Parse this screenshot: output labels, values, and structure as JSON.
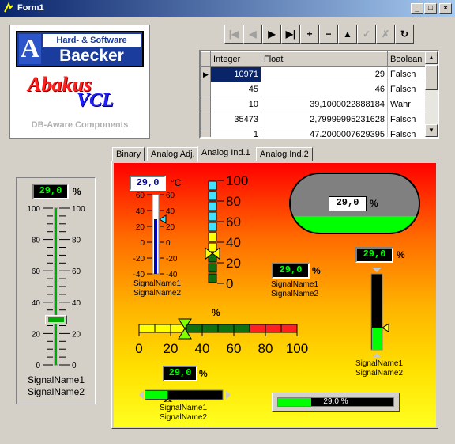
{
  "window": {
    "title": "Form1",
    "controls": {
      "minimize": "_",
      "maximize": "□",
      "close": "×"
    }
  },
  "logo": {
    "line1": "Hard- & Software",
    "line2": "Baecker",
    "brand1": "Abakus",
    "brand2": "VCL",
    "tagline": "DB-Aware Components"
  },
  "navigator": {
    "buttons": [
      {
        "name": "first",
        "glyph": "|◀",
        "enabled": false
      },
      {
        "name": "prior",
        "glyph": "◀",
        "enabled": false
      },
      {
        "name": "next",
        "glyph": "▶",
        "enabled": true
      },
      {
        "name": "last",
        "glyph": "▶|",
        "enabled": true
      },
      {
        "name": "insert",
        "glyph": "+",
        "enabled": true
      },
      {
        "name": "delete",
        "glyph": "−",
        "enabled": true
      },
      {
        "name": "edit",
        "glyph": "▲",
        "enabled": true
      },
      {
        "name": "post",
        "glyph": "✓",
        "enabled": false
      },
      {
        "name": "cancel",
        "glyph": "✗",
        "enabled": false
      },
      {
        "name": "refresh",
        "glyph": "↻",
        "enabled": true
      }
    ]
  },
  "grid": {
    "columns": [
      "Integer",
      "Float",
      "Boolean"
    ],
    "rows": [
      [
        "10971",
        "29",
        "Falsch"
      ],
      [
        "45",
        "46",
        "Falsch"
      ],
      [
        "10",
        "39,1000022888184",
        "Wahr"
      ],
      [
        "35473",
        "2,79999995231628",
        "Falsch"
      ],
      [
        "1",
        "47,2000007629395",
        "Falsch"
      ]
    ],
    "selected_row": 0
  },
  "tabs": [
    "Binary",
    "Analog Adj.",
    "Analog Ind.1",
    "Analog Ind.2"
  ],
  "active_tab": "Analog Ind.1",
  "value": "29,0",
  "value_num": 29,
  "slider": {
    "value": "29,0",
    "unit": "%",
    "ticks": [
      "100",
      "80",
      "60",
      "40",
      "20",
      "0"
    ],
    "signal1": "SignalName1",
    "signal2": "SignalName2"
  },
  "thermometer": {
    "value": "29,0",
    "unit": "°C",
    "ticks": [
      "60",
      "40",
      "20",
      "0",
      "-20",
      "-40"
    ],
    "signal1": "SignalName1",
    "signal2": "SignalName2"
  },
  "bar_scale": {
    "ticks": [
      "100",
      "80",
      "60",
      "40",
      "20",
      "0"
    ]
  },
  "tank": {
    "value": "29,0",
    "unit": "%"
  },
  "lcd_center": {
    "value": "29,0",
    "unit": "%",
    "signal1": "SignalName1",
    "signal2": "SignalName2"
  },
  "horizontal_meter": {
    "unit": "%",
    "ticks": [
      "0",
      "20",
      "40",
      "60",
      "80",
      "100"
    ]
  },
  "vertical_meter": {
    "value": "29,0",
    "unit": "%",
    "signal1": "SignalName1",
    "signal2": "SignalName2"
  },
  "small_hbar": {
    "value": "29,0",
    "unit": "%",
    "signal1": "SignalName1",
    "signal2": "SignalName2"
  },
  "progress": {
    "text": "29,0 %"
  },
  "colors": {
    "titlebar": "#0a246a",
    "accent_green": "#00ff00",
    "scale_blue": "#0000cc",
    "cyan": "#40e0ff",
    "tank_gray": "#808080"
  }
}
